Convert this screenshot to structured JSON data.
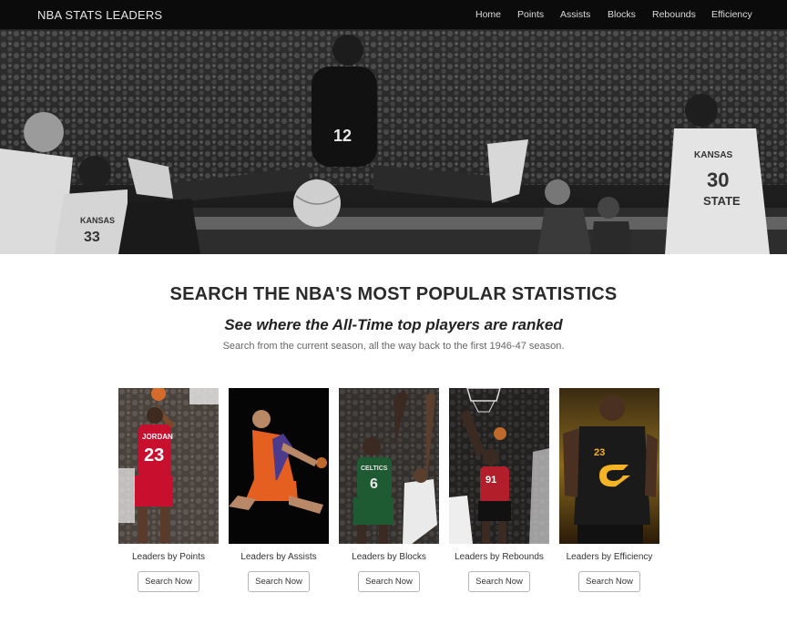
{
  "navbar": {
    "brand": "NBA STATS LEADERS",
    "links": [
      "Home",
      "Points",
      "Assists",
      "Blocks",
      "Rebounds",
      "Efficiency"
    ]
  },
  "hero": {
    "jerseys": [
      "12",
      "KANSAS",
      "30",
      "STATE",
      "KANSAS",
      "33"
    ]
  },
  "intro": {
    "title": "SEARCH THE NBA'S MOST POPULAR STATISTICS",
    "subtitle": "See where the All-Time top players are ranked",
    "blurb": "Search from the current season, all the way back to the first 1946-47 season."
  },
  "cards": [
    {
      "label": "Leaders by Points",
      "button": "Search Now",
      "jersey_text": "JORDAN",
      "jersey_number": "23",
      "color": "#c8102e"
    },
    {
      "label": "Leaders by Assists",
      "button": "Search Now",
      "jersey_text": "",
      "jersey_number": "",
      "color": "#e56020"
    },
    {
      "label": "Leaders by Blocks",
      "button": "Search Now",
      "jersey_text": "CELTICS",
      "jersey_number": "6",
      "color": "#1e5a32"
    },
    {
      "label": "Leaders by Rebounds",
      "button": "Search Now",
      "jersey_text": "",
      "jersey_number": "91",
      "color": "#b21e2a"
    },
    {
      "label": "Leaders by Efficiency",
      "button": "Search Now",
      "jersey_text": "",
      "jersey_number": "23",
      "color": "#1a1a1a"
    }
  ],
  "colors": {
    "navbar_bg": "#0b0b0b",
    "accent_gold": "#f5b423"
  }
}
